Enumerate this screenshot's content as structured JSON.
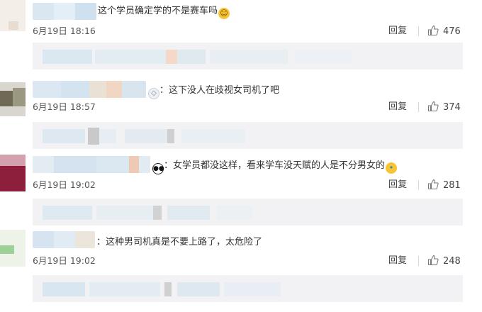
{
  "comments": [
    {
      "text": "这个学员确定学的不是赛车吗",
      "emoji": "laugh-cry-emoji",
      "date": "6月19日 18:16",
      "reply": "回复",
      "likes": "476"
    },
    {
      "prefix_icon": "diamond-ring-badge",
      "text": "：这下没人在歧视女司机了吧",
      "date": "6月19日 18:57",
      "reply": "回复",
      "likes": "374"
    },
    {
      "prefix_icon": "panda-badge",
      "text": "：女学员都没这样，看来学车没天赋的人是不分男女的",
      "emoji": "sweat-emoji",
      "date": "6月19日 19:02",
      "reply": "回复",
      "likes": "281"
    },
    {
      "text": "：这种男司机真是不要上路了，太危险了",
      "date": "6月19日 19:02",
      "reply": "回复",
      "likes": "248"
    }
  ],
  "colors": {
    "sub_reply_bg": "#f2f2f5",
    "blur_blue": "#d7e6f2",
    "text": "#333333"
  }
}
